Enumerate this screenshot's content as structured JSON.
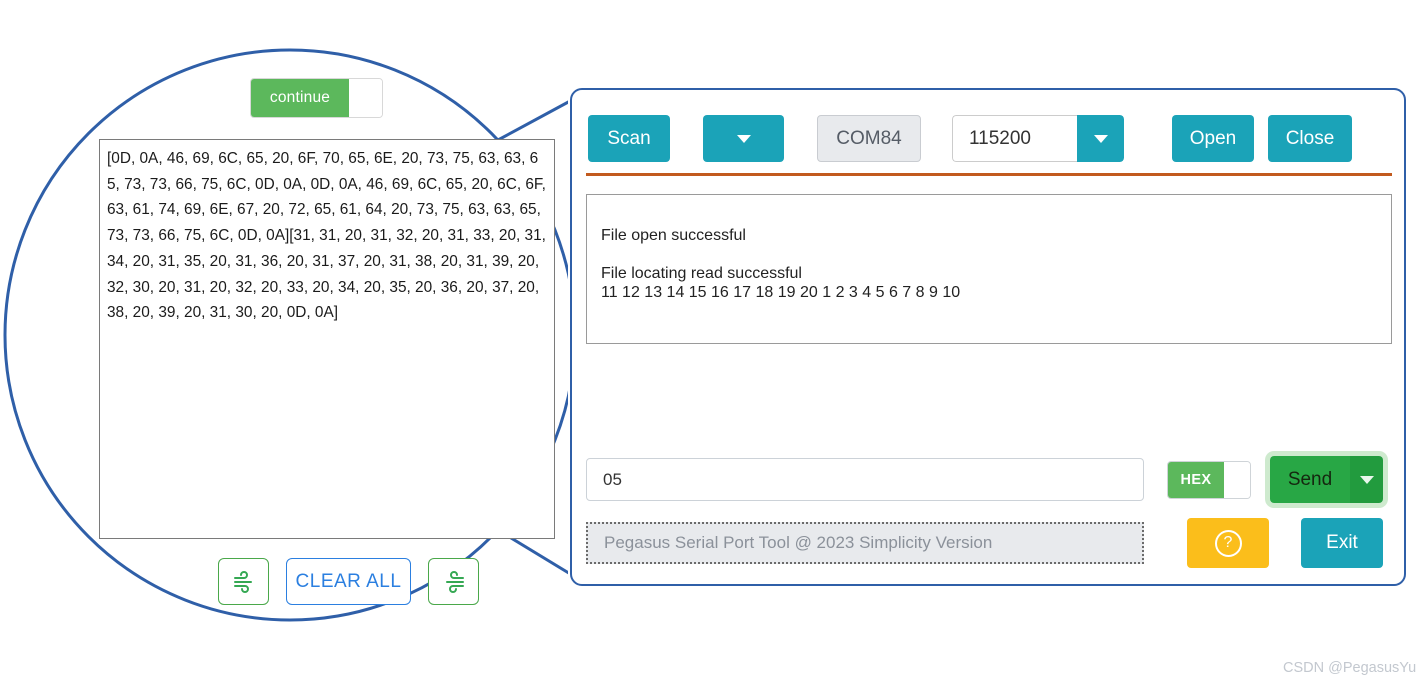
{
  "magnified": {
    "continue_button": {
      "label": "continue",
      "dropdown_icon": "chevron-down-icon"
    },
    "hex_output": "[0D, 0A, 46, 69, 6C, 65, 20, 6F, 70, 65, 6E, 20, 73, 75, 63, 63, 65, 73, 73, 66, 75, 6C, 0D, 0A, 0D, 0A, 46, 69, 6C, 65, 20, 6C, 6F, 63, 61, 74, 69, 6E, 67, 20, 72, 65, 61, 64, 20, 73, 75, 63, 63, 65, 73, 73, 66, 75, 6C, 0D, 0A][31, 31, 20, 31, 32, 20, 31, 33, 20, 31, 34, 20, 31, 35, 20, 31, 36, 20, 31, 37, 20, 31, 38, 20, 31, 39, 20, 32, 30, 20, 31, 20, 32, 20, 33, 20, 34, 20, 35, 20, 36, 20, 37, 20, 38, 20, 39, 20, 31, 30, 20, 0D, 0A]",
    "clear_all_label": "CLEAR ALL",
    "left_icon": "wind-icon",
    "right_icon": "wind-reverse-icon"
  },
  "toolbar": {
    "scan_label": "Scan",
    "scan_dropdown_icon": "chevron-down-icon",
    "port_value": "COM84",
    "baud_value": "115200",
    "baud_dropdown_icon": "chevron-down-icon",
    "open_label": "Open",
    "close_label": "Close"
  },
  "log": {
    "text": "\nFile open successful\n\nFile locating read successful\n11 12 13 14 15 16 17 18 19 20 1 2 3 4 5 6 7 8 9 10"
  },
  "send": {
    "input_value": "05",
    "input_placeholder": "",
    "hex_label": "HEX",
    "hex_enabled": "on",
    "send_label": "Send",
    "send_dropdown_icon": "chevron-down-icon"
  },
  "status": {
    "text": "Pegasus Serial Port Tool @ 2023 Simplicity Version",
    "help_icon": "question-circle-icon",
    "exit_label": "Exit"
  },
  "watermark": {
    "text": "CSDN @PegasusYu"
  },
  "colors": {
    "teal": "#1ba3b8",
    "green": "#5cb85c",
    "send_green": "#28a745",
    "blue_outline": "#2f5fa8",
    "orange_separator": "#c25a1e",
    "amber": "#fbbe1b",
    "clear_blue": "#2b7fe0"
  }
}
